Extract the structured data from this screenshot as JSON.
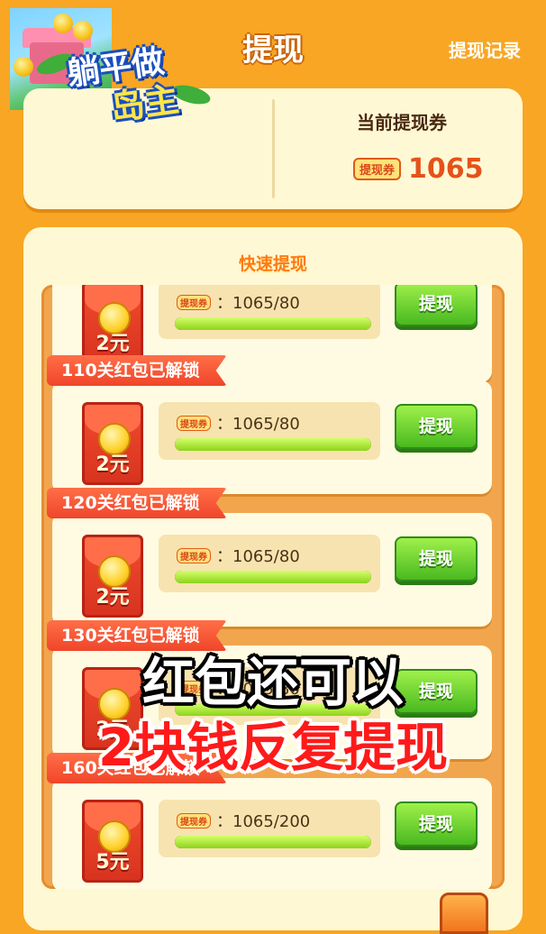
{
  "header": {
    "title": "提现",
    "history_link": "提现记录"
  },
  "top_card": {
    "game_logo_line1": "躺平做",
    "game_logo_line2": "岛主",
    "ticket_label": "当前提现券",
    "ticket_badge": "提现券",
    "ticket_count": "1065"
  },
  "panel": {
    "title": "快速提现"
  },
  "rows": [
    {
      "banner": "",
      "amount": "2元",
      "badge": "提现券",
      "progress_text": "：1065/80",
      "progress_fraction": 1.0,
      "button": "提现"
    },
    {
      "banner": "110关红包已解锁",
      "amount": "2元",
      "badge": "提现券",
      "progress_text": "：1065/80",
      "progress_fraction": 1.0,
      "button": "提现"
    },
    {
      "banner": "120关红包已解锁",
      "amount": "2元",
      "badge": "提现券",
      "progress_text": "：1065/80",
      "progress_fraction": 1.0,
      "button": "提现"
    },
    {
      "banner": "130关红包已解锁",
      "amount": "2元",
      "badge": "提现券",
      "progress_text": "：1065/80",
      "progress_fraction": 1.0,
      "button": "提现"
    },
    {
      "banner": "160关红包已解锁",
      "amount": "5元",
      "badge": "提现券",
      "progress_text": "：1065/200",
      "progress_fraction": 1.0,
      "button": "提现"
    }
  ],
  "overlay": {
    "line1": "红包还可以",
    "line2": "2块钱反复提现"
  },
  "colors": {
    "background": "#f8a623",
    "card": "#fff8d4",
    "accent_red": "#f0452a",
    "button_green": "#49b920"
  }
}
